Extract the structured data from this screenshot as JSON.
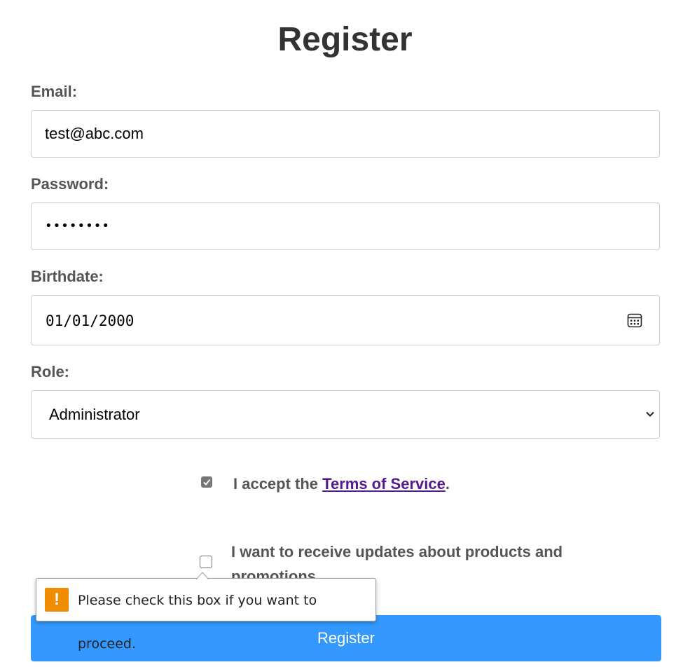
{
  "form": {
    "title": "Register",
    "email": {
      "label": "Email:",
      "value": "test@abc.com"
    },
    "password": {
      "label": "Password:",
      "value": "••••••••"
    },
    "birthdate": {
      "label": "Birthdate:",
      "value": "01/01/2000"
    },
    "role": {
      "label": "Role:",
      "selected": "Administrator"
    },
    "terms": {
      "checked": true,
      "text_before": "I accept the ",
      "link_text": "Terms of Service",
      "text_after": "."
    },
    "updates": {
      "checked": false,
      "line1": "I want to receive updates about products and",
      "line2": "promotions."
    },
    "submit_label": "Register"
  },
  "validation_tooltip": {
    "icon": "warning-icon",
    "icon_glyph": "!",
    "message": "Please check this box if you want to proceed."
  },
  "colors": {
    "button": "#3399ff",
    "link": "#551a8b",
    "warning": "#f08c00"
  }
}
